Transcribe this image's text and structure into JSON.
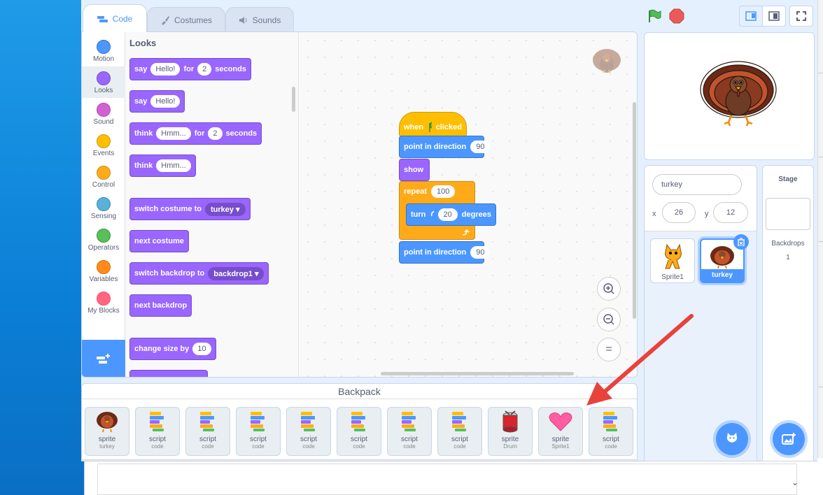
{
  "tabs": [
    {
      "label": "Code"
    },
    {
      "label": "Costumes"
    },
    {
      "label": "Sounds"
    }
  ],
  "categories": [
    {
      "label": "Motion",
      "color": "#4c97ff"
    },
    {
      "label": "Looks",
      "color": "#9966ff"
    },
    {
      "label": "Sound",
      "color": "#cf63cf"
    },
    {
      "label": "Events",
      "color": "#ffbf00"
    },
    {
      "label": "Control",
      "color": "#ffab19"
    },
    {
      "label": "Sensing",
      "color": "#5cb1d6"
    },
    {
      "label": "Operators",
      "color": "#59c059"
    },
    {
      "label": "Variables",
      "color": "#ff8c1a"
    },
    {
      "label": "My Blocks",
      "color": "#ff6680"
    }
  ],
  "palette": {
    "heading": "Looks",
    "say_for": {
      "w1": "say",
      "arg1": "Hello!",
      "w2": "for",
      "arg2": "2",
      "w3": "seconds"
    },
    "say": {
      "w1": "say",
      "arg1": "Hello!"
    },
    "think_for": {
      "w1": "think",
      "arg1": "Hmm...",
      "w2": "for",
      "arg2": "2",
      "w3": "seconds"
    },
    "think": {
      "w1": "think",
      "arg1": "Hmm..."
    },
    "switch_costume": {
      "w1": "switch costume to",
      "arg1": "turkey"
    },
    "next_costume": {
      "w1": "next costume"
    },
    "switch_backdrop": {
      "w1": "switch backdrop to",
      "arg1": "backdrop1"
    },
    "next_backdrop": {
      "w1": "next backdrop"
    },
    "change_size": {
      "w1": "change size by",
      "arg1": "10"
    }
  },
  "script": {
    "hat": {
      "w1": "when",
      "w2": "clicked"
    },
    "point1": {
      "w1": "point in direction",
      "arg1": "90"
    },
    "show": {
      "w1": "show"
    },
    "repeat": {
      "w1": "repeat",
      "arg1": "100"
    },
    "turn": {
      "w1": "turn",
      "arg1": "20",
      "w2": "degrees"
    },
    "point2": {
      "w1": "point in direction",
      "arg1": "90"
    }
  },
  "zoom": {
    "reset": "="
  },
  "backpack": {
    "title": "Backpack",
    "items": [
      {
        "t1": "sprite",
        "t2": "turkey"
      },
      {
        "t1": "script",
        "t2": "code"
      },
      {
        "t1": "script",
        "t2": "code"
      },
      {
        "t1": "script",
        "t2": "code"
      },
      {
        "t1": "script",
        "t2": "code"
      },
      {
        "t1": "script",
        "t2": "code"
      },
      {
        "t1": "script",
        "t2": "code"
      },
      {
        "t1": "script",
        "t2": "code"
      },
      {
        "t1": "sprite",
        "t2": "Drum"
      },
      {
        "t1": "sprite",
        "t2": "Sprite1"
      },
      {
        "t1": "script",
        "t2": "code"
      }
    ]
  },
  "sprite_info": {
    "name": "turkey",
    "x_label": "x",
    "x": "26",
    "y_label": "y",
    "y": "12"
  },
  "sprites": [
    {
      "name": "Sprite1"
    },
    {
      "name": "turkey",
      "selected": true
    }
  ],
  "stage_panel": {
    "title": "Stage",
    "backdrops_label": "Backdrops",
    "backdrops_count": "1"
  },
  "colors": {
    "accent": "#4c97ff",
    "looks": "#9966ff",
    "motion": "#4c97ff",
    "control": "#ffab19",
    "events": "#ffbf00",
    "arrow": "#e8423a"
  }
}
